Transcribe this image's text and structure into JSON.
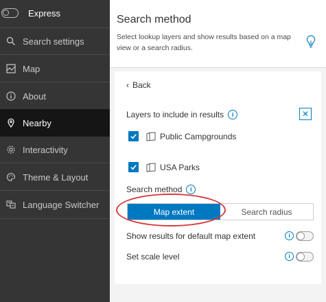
{
  "sidebar": {
    "express_label": "Express",
    "items": [
      {
        "label": "Search settings",
        "icon": "search-icon"
      },
      {
        "label": "Map",
        "icon": "map-icon"
      },
      {
        "label": "About",
        "icon": "info-icon"
      },
      {
        "label": "Nearby",
        "icon": "location-pin-icon",
        "active": true
      },
      {
        "label": "Interactivity",
        "icon": "gear-icon"
      },
      {
        "label": "Theme & Layout",
        "icon": "palette-icon"
      },
      {
        "label": "Language Switcher",
        "icon": "language-icon"
      }
    ]
  },
  "header": {
    "title": "Search method",
    "description": "Select lookup layers and show results based on a map view or a search radius."
  },
  "panel": {
    "back_label": "Back",
    "layers_title": "Layers to include in results",
    "layers": [
      {
        "name": "Public Campgrounds",
        "checked": true
      },
      {
        "name": "USA Parks",
        "checked": true
      }
    ],
    "search_method_label": "Search method",
    "segments": {
      "active": "Map extent",
      "inactive": "Search radius"
    },
    "options": [
      {
        "label": "Show results for default map extent",
        "enabled": false
      },
      {
        "label": "Set scale level",
        "enabled": false
      }
    ]
  },
  "colors": {
    "accent": "#0079c1",
    "sidebar_bg": "#353535",
    "active_bg": "#151515",
    "highlight": "#d8393c"
  }
}
